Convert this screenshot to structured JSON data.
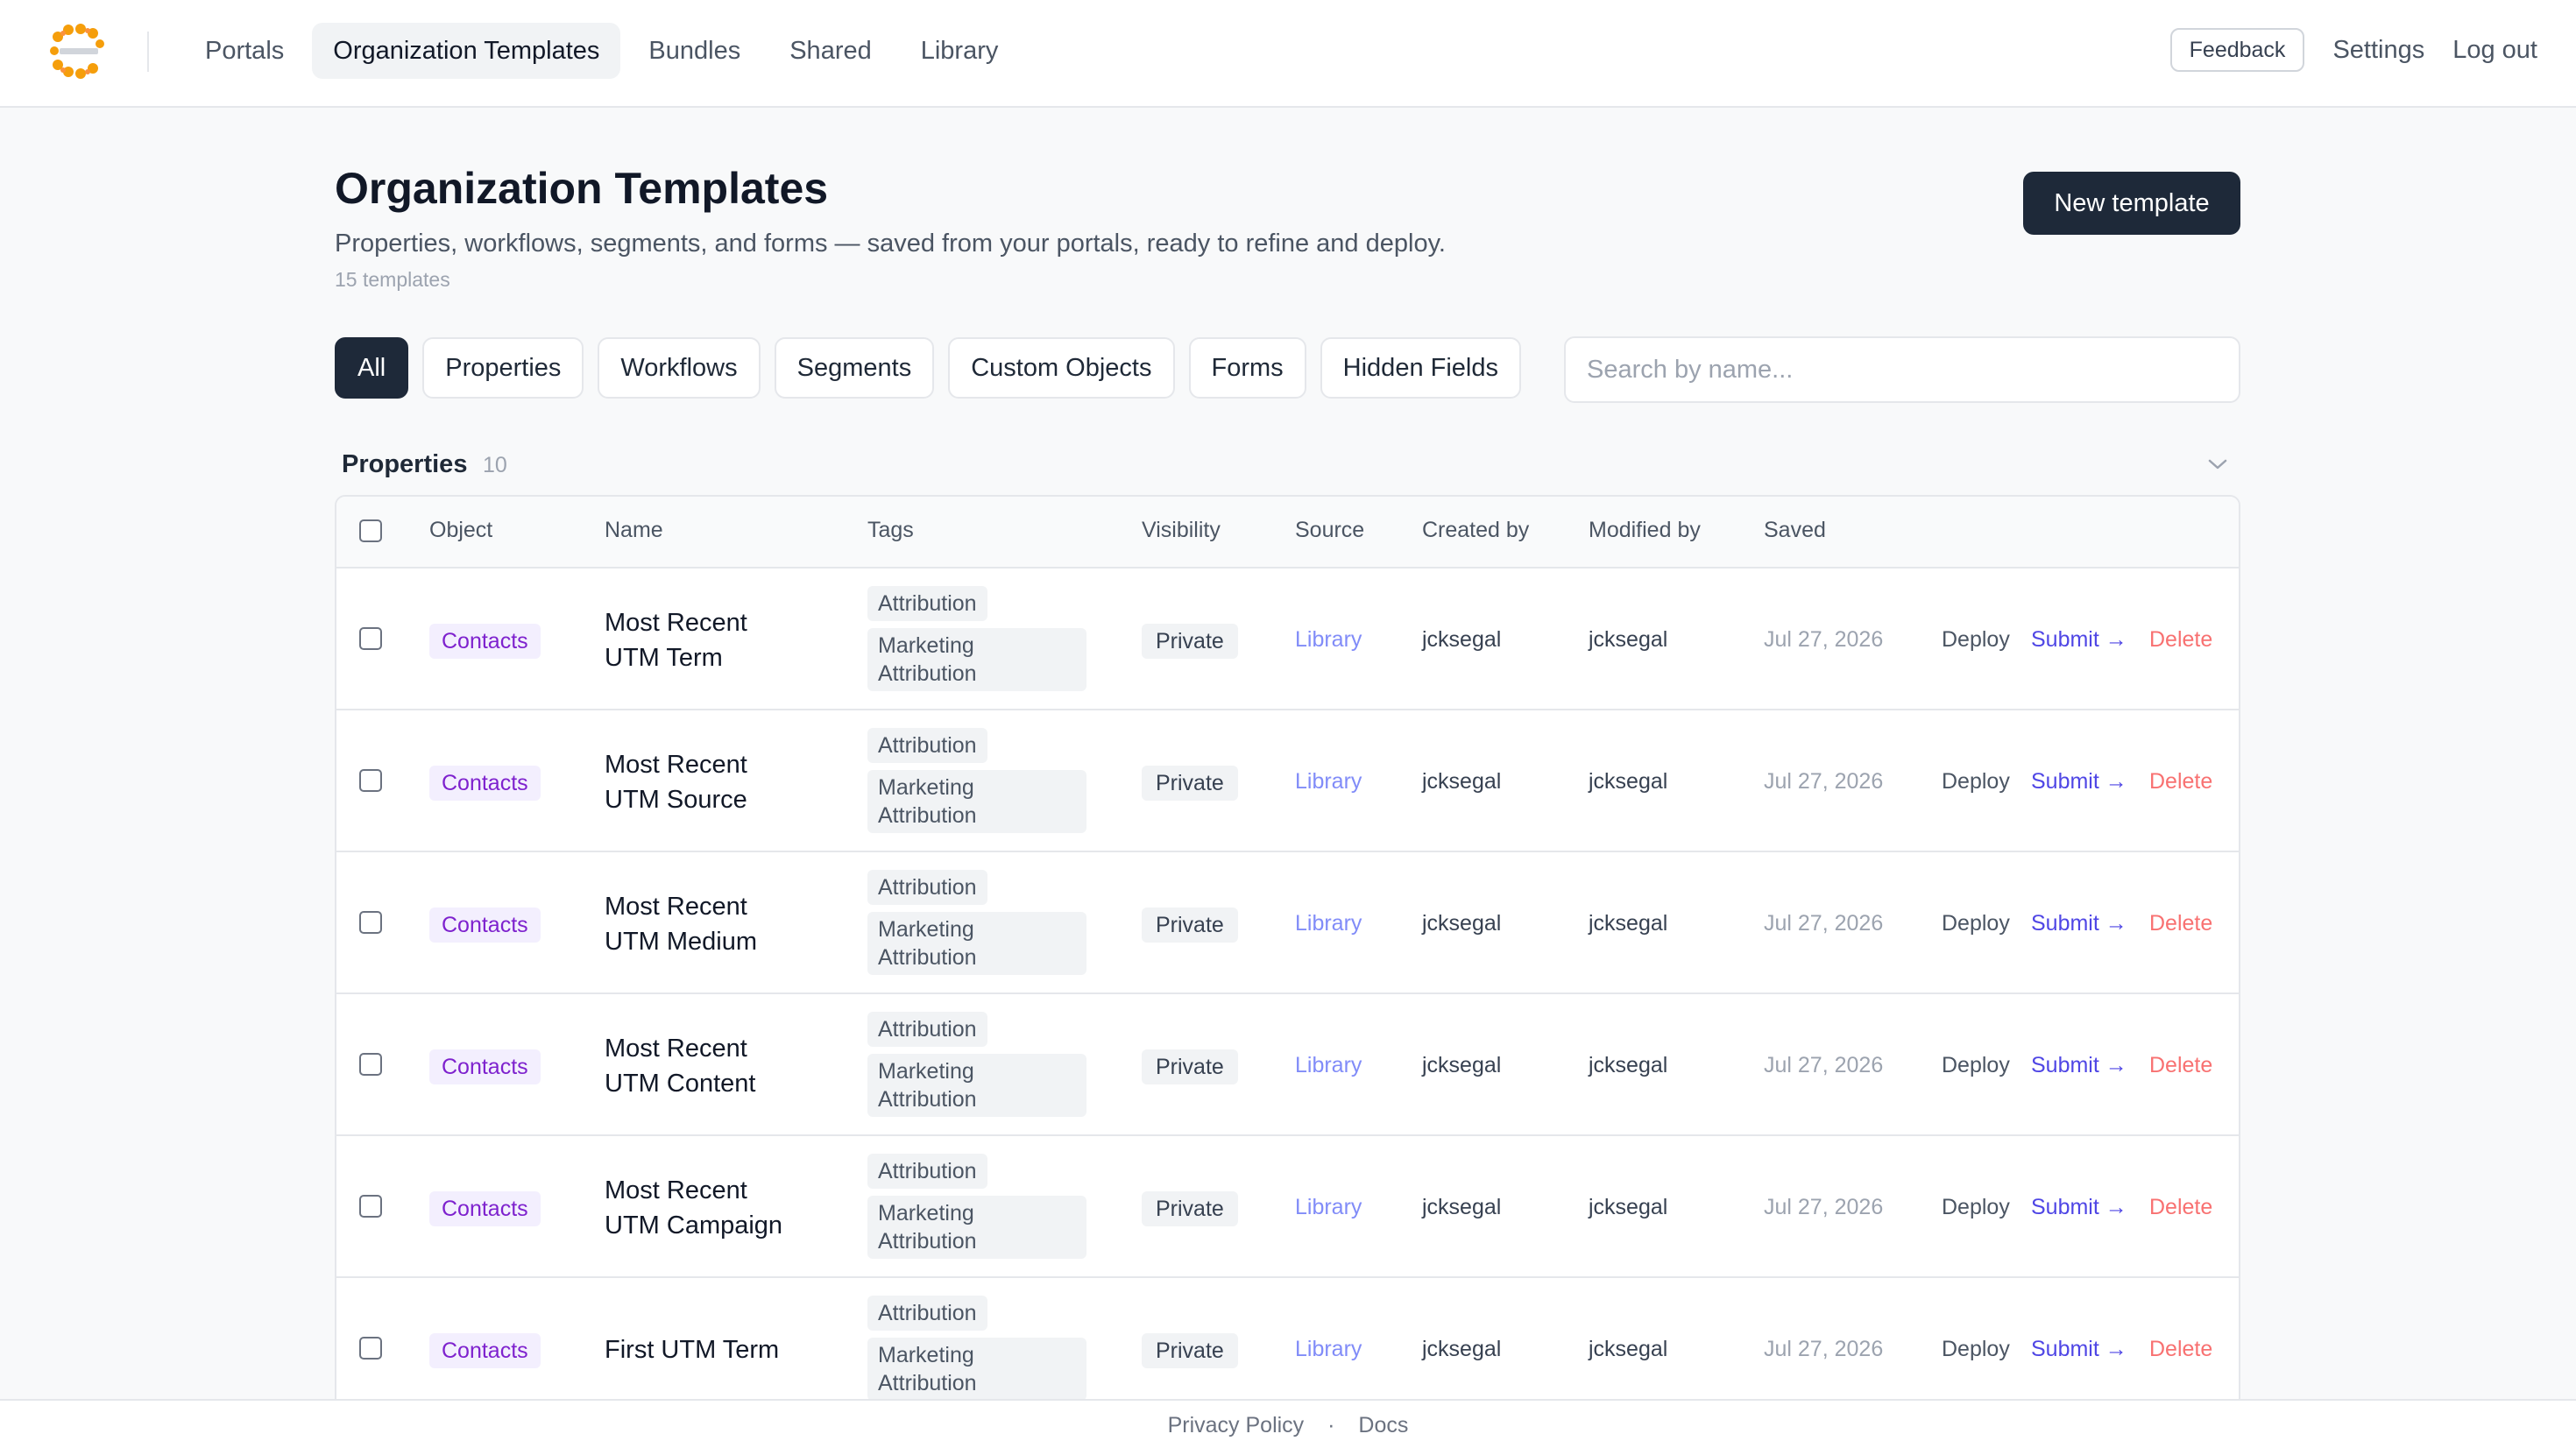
{
  "nav": {
    "tabs": [
      "Portals",
      "Organization Templates",
      "Bundles",
      "Shared",
      "Library"
    ],
    "active_tab": "Organization Templates",
    "feedback_label": "Feedback",
    "settings_label": "Settings",
    "logout_label": "Log out"
  },
  "header": {
    "title": "Organization Templates",
    "subtitle": "Properties, workflows, segments, and forms — saved from your portals, ready to refine and deploy.",
    "count": "15 templates",
    "new_button": "New template"
  },
  "filters": {
    "chips": [
      "All",
      "Properties",
      "Workflows",
      "Segments",
      "Custom Objects",
      "Forms",
      "Hidden Fields"
    ],
    "active": "All",
    "search_placeholder": "Search by name..."
  },
  "section": {
    "title": "Properties",
    "count": "10"
  },
  "table": {
    "columns": [
      "Object",
      "Name",
      "Tags",
      "Visibility",
      "Source",
      "Created by",
      "Modified by",
      "Saved"
    ],
    "rows": [
      {
        "object": "Contacts",
        "name_l1": "Most Recent",
        "name_l2": "UTM Term",
        "tag1": "Attribution",
        "tag2": "Marketing Attribution",
        "visibility": "Private",
        "source": "Library",
        "created_by": "jcksegal",
        "modified_by": "jcksegal",
        "saved": "Jul 27, 2026",
        "deploy": "Deploy",
        "submit": "Submit →",
        "delete": "Delete"
      },
      {
        "object": "Contacts",
        "name_l1": "Most Recent",
        "name_l2": "UTM Source",
        "tag1": "Attribution",
        "tag2": "Marketing Attribution",
        "visibility": "Private",
        "source": "Library",
        "created_by": "jcksegal",
        "modified_by": "jcksegal",
        "saved": "Jul 27, 2026",
        "deploy": "Deploy",
        "submit": "Submit →",
        "delete": "Delete"
      },
      {
        "object": "Contacts",
        "name_l1": "Most Recent",
        "name_l2": "UTM Medium",
        "tag1": "Attribution",
        "tag2": "Marketing Attribution",
        "visibility": "Private",
        "source": "Library",
        "created_by": "jcksegal",
        "modified_by": "jcksegal",
        "saved": "Jul 27, 2026",
        "deploy": "Deploy",
        "submit": "Submit →",
        "delete": "Delete"
      },
      {
        "object": "Contacts",
        "name_l1": "Most Recent",
        "name_l2": "UTM Content",
        "tag1": "Attribution",
        "tag2": "Marketing Attribution",
        "visibility": "Private",
        "source": "Library",
        "created_by": "jcksegal",
        "modified_by": "jcksegal",
        "saved": "Jul 27, 2026",
        "deploy": "Deploy",
        "submit": "Submit →",
        "delete": "Delete"
      },
      {
        "object": "Contacts",
        "name_l1": "Most Recent",
        "name_l2": "UTM Campaign",
        "tag1": "Attribution",
        "tag2": "Marketing Attribution",
        "visibility": "Private",
        "source": "Library",
        "created_by": "jcksegal",
        "modified_by": "jcksegal",
        "saved": "Jul 27, 2026",
        "deploy": "Deploy",
        "submit": "Submit →",
        "delete": "Delete"
      },
      {
        "object": "Contacts",
        "name_l1": "First UTM Term",
        "name_l2": "",
        "tag1": "Attribution",
        "tag2": "Marketing Attribution",
        "visibility": "Private",
        "source": "Library",
        "created_by": "jcksegal",
        "modified_by": "jcksegal",
        "saved": "Jul 27, 2026",
        "deploy": "Deploy",
        "submit": "Submit →",
        "delete": "Delete"
      }
    ]
  },
  "footer": {
    "privacy": "Privacy Policy",
    "separator": "·",
    "docs": "Docs"
  },
  "icons": {
    "logo": "flower-wreath-logo",
    "chevron": "chevron-down-icon"
  },
  "colors": {
    "primary": "#1e2939",
    "object_badge": "#7e22ce",
    "submit": "#4f46e5",
    "delete": "#f87171",
    "source": "#818cf8"
  }
}
